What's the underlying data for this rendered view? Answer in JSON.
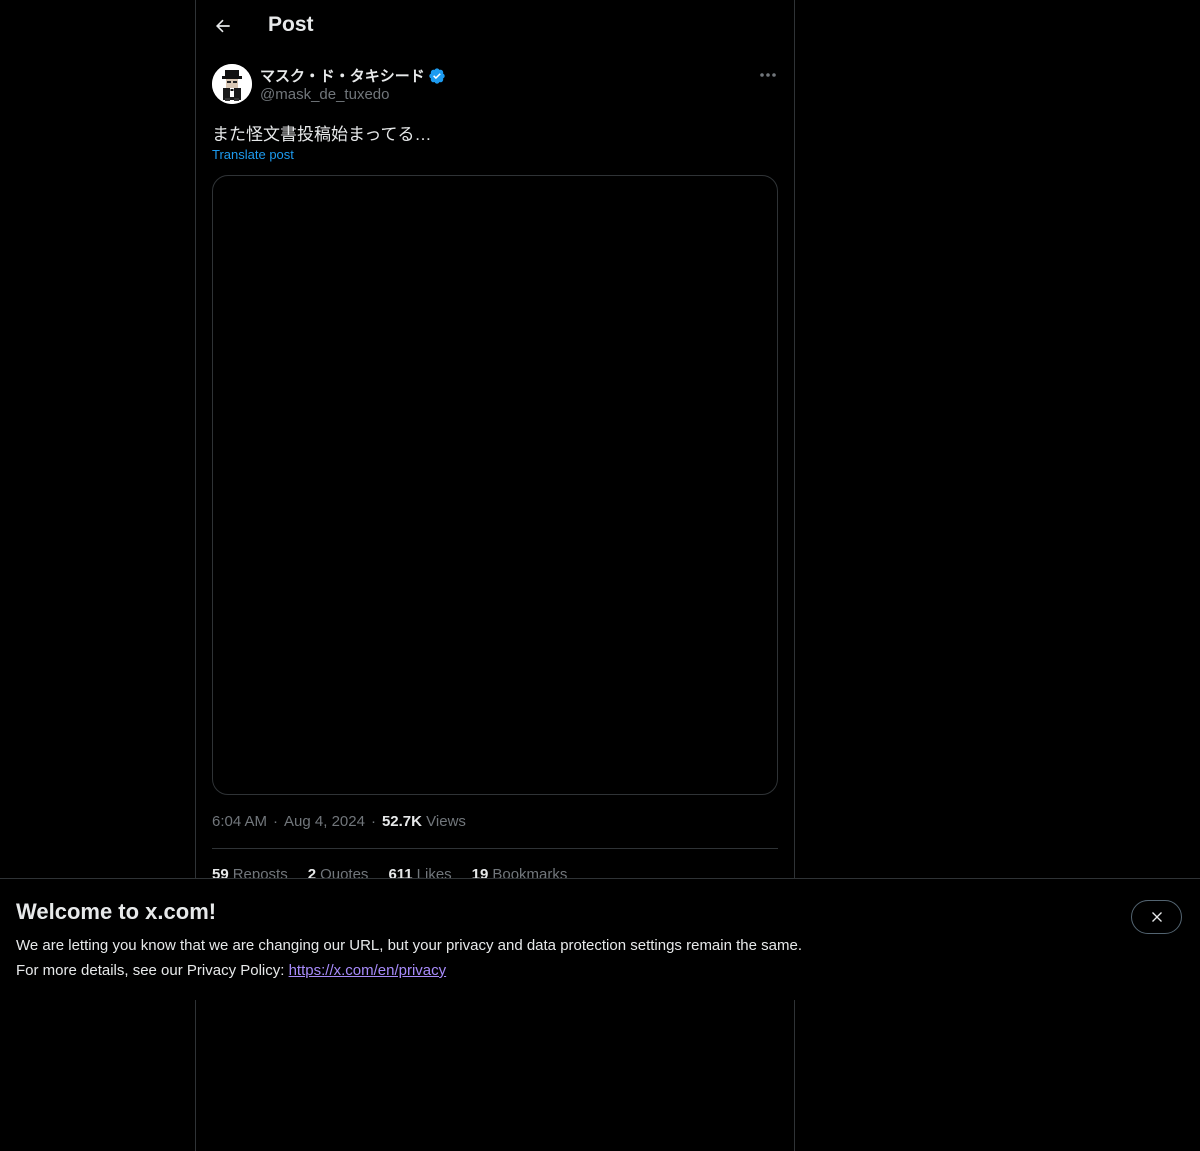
{
  "header": {
    "title": "Post",
    "back_icon": "arrow-left-icon"
  },
  "post": {
    "author": {
      "display_name": "マスク・ド・タキシード",
      "handle": "@mask_de_tuxedo",
      "verified": true,
      "verified_color": "#1d9bf0"
    },
    "text": "また怪文書投稿始まってる…",
    "translate_label": "Translate post",
    "meta": {
      "time": "6:04 AM",
      "date": "Aug 4, 2024",
      "views_count": "52.7K",
      "views_label": "Views"
    },
    "stats": {
      "reposts_count": "59",
      "reposts_label": "Reposts",
      "quotes_count": "2",
      "quotes_label": "Quotes",
      "likes_count": "611",
      "likes_label": "Likes",
      "bookmarks_count": "19",
      "bookmarks_label": "Bookmarks"
    }
  },
  "banner": {
    "title": "Welcome to x.com!",
    "line1": "We are letting you know that we are changing our URL, but your privacy and data protection settings remain the same.",
    "line2_prefix": "For more details, see our Privacy Policy: ",
    "link_text": "https://x.com/en/privacy",
    "close_icon": "close-icon"
  },
  "colors": {
    "background": "#000000",
    "text": "#e7e9ea",
    "muted": "#71767b",
    "accent": "#1d9bf0",
    "border": "#2f3336",
    "link": "#a78bfa"
  }
}
